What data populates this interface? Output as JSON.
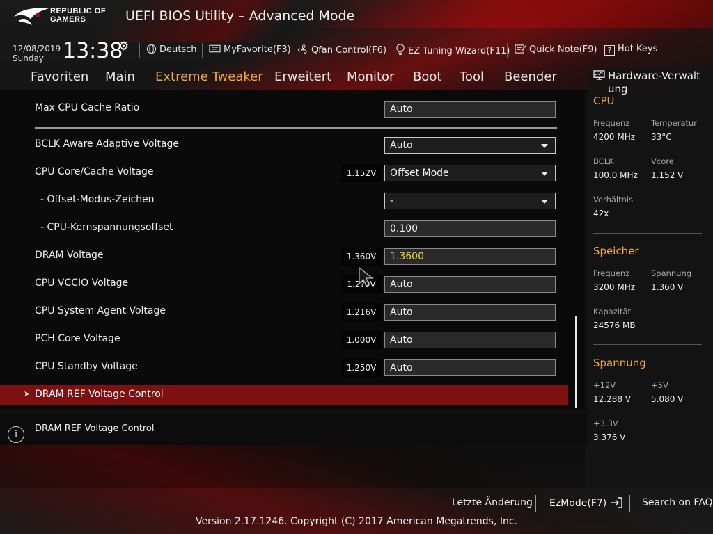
{
  "brand": {
    "logo_text_line1": "REPUBLIC OF",
    "logo_text_line2": "GAMERS"
  },
  "title": "UEFI BIOS Utility – Advanced Mode",
  "status": {
    "date": "12/08/2019",
    "day": "Sunday",
    "time": "13:38",
    "items": [
      {
        "icon": "globe-icon",
        "label": "Deutsch"
      },
      {
        "icon": "favorite-icon",
        "label": "MyFavorite(F3)"
      },
      {
        "icon": "fan-icon",
        "label": "Qfan Control(F6)"
      },
      {
        "icon": "lightbulb-icon",
        "label": "EZ Tuning Wizard(F11)"
      },
      {
        "icon": "note-icon",
        "label": "Quick Note(F9)"
      },
      {
        "icon": "help-icon",
        "label": "Hot Keys"
      }
    ]
  },
  "tabs": [
    {
      "label": "Favoriten",
      "active": false
    },
    {
      "label": "Main",
      "active": false
    },
    {
      "label": "Extreme Tweaker",
      "active": true
    },
    {
      "label": "Erweitert",
      "active": false
    },
    {
      "label": "Monitor",
      "active": false
    },
    {
      "label": "Boot",
      "active": false
    },
    {
      "label": "Tool",
      "active": false
    },
    {
      "label": "Beender",
      "active": false
    }
  ],
  "settings": [
    {
      "label": "Max CPU Cache Ratio",
      "voltage": "",
      "value": "Auto",
      "type": "input"
    },
    {
      "label": "BCLK Aware Adaptive Voltage",
      "voltage": "",
      "value": "Auto",
      "type": "dropdown"
    },
    {
      "label": "CPU Core/Cache Voltage",
      "voltage": "1.152V",
      "value": "Offset Mode",
      "type": "dropdown"
    },
    {
      "label": "- Offset-Modus-Zeichen",
      "voltage": "",
      "value": "-",
      "type": "dropdown"
    },
    {
      "label": "- CPU-Kernspannungsoffset",
      "voltage": "",
      "value": "0.100",
      "type": "input"
    },
    {
      "label": "DRAM Voltage",
      "voltage": "1.360V",
      "value": "1.3600",
      "type": "input"
    },
    {
      "label": "CPU VCCIO Voltage",
      "voltage": "1.2?0V",
      "value": "Auto",
      "type": "input"
    },
    {
      "label": "CPU System Agent Voltage",
      "voltage": "1.216V",
      "value": "Auto",
      "type": "input"
    },
    {
      "label": "PCH Core Voltage",
      "voltage": "1.000V",
      "value": "Auto",
      "type": "input"
    },
    {
      "label": "CPU Standby Voltage",
      "voltage": "1.250V",
      "value": "Auto",
      "type": "input"
    }
  ],
  "submenu": {
    "label": "DRAM REF Voltage Control"
  },
  "help": {
    "text": "DRAM REF Voltage Control"
  },
  "hardware": {
    "title": "Hardware-Verwaltung",
    "cpu": {
      "title": "CPU",
      "freq_label": "Frequenz",
      "freq": "4200 MHz",
      "temp_label": "Temperatur",
      "temp": "33°C",
      "bclk_label": "BCLK",
      "bclk": "100.0 MHz",
      "vcore_label": "Vcore",
      "vcore": "1.152 V",
      "ratio_label": "Verhältnis",
      "ratio": "42x"
    },
    "memory": {
      "title": "Speicher",
      "freq_label": "Frequenz",
      "freq": "3200 MHz",
      "volt_label": "Spannung",
      "volt": "1.360 V",
      "cap_label": "Kapazität",
      "cap": "24576 MB"
    },
    "voltage": {
      "title": "Spannung",
      "v12_label": "+12V",
      "v12": "12.288 V",
      "v5_label": "+5V",
      "v5": "5.080 V",
      "v33_label": "+3.3V",
      "v33": "3.376 V"
    }
  },
  "footer": {
    "last_change": "Letzte Änderung",
    "ezmode": "EzMode(F7)",
    "faq": "Search on FAQ",
    "copyright": "Version 2.17.1246. Copyright (C) 2017 American Megatrends, Inc."
  },
  "colors": {
    "accent": "#f2a93b",
    "highlight": "#7d1010",
    "dram_value": "#f2d23a"
  }
}
